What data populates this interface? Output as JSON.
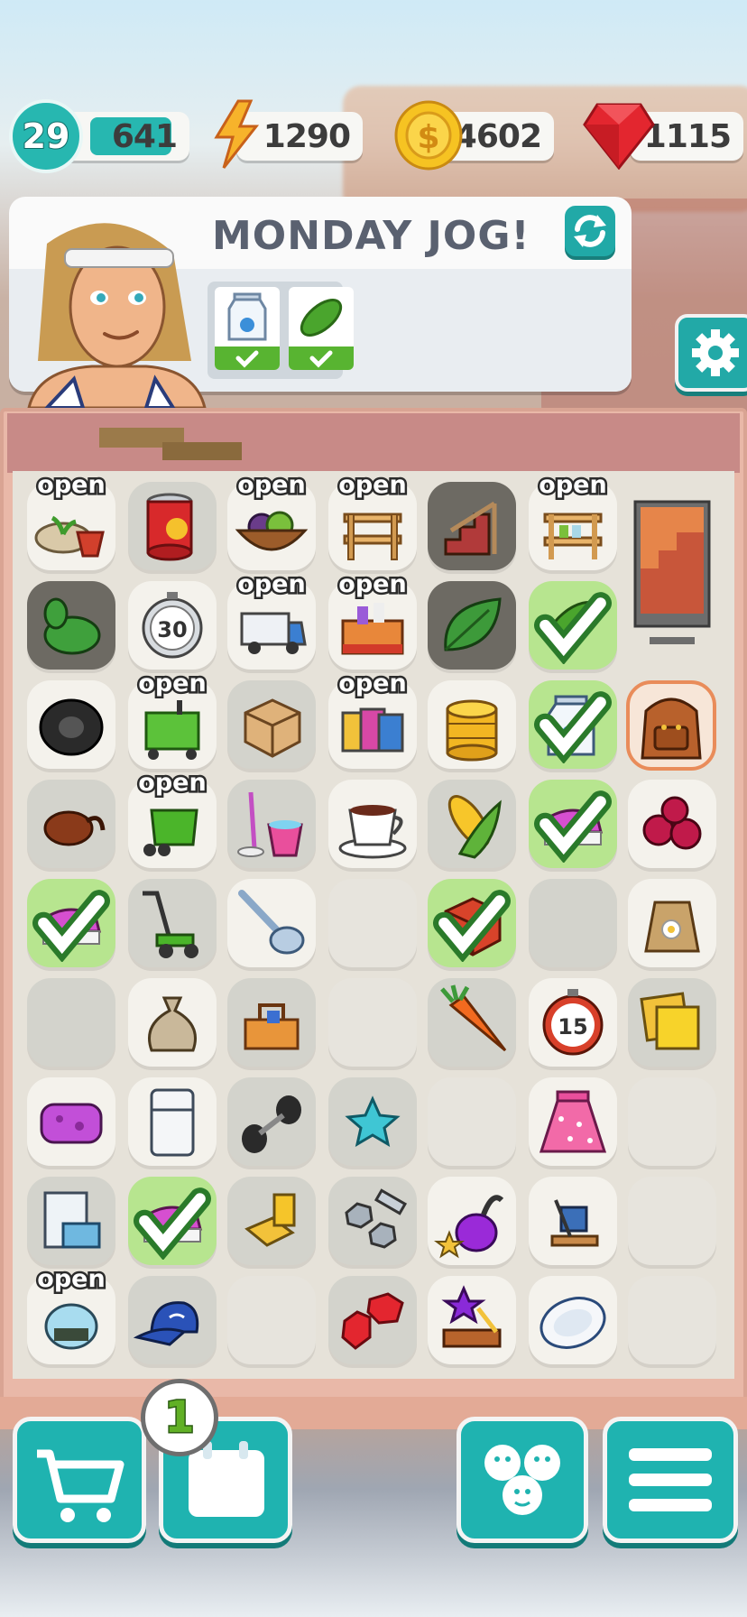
{
  "status_bar": {
    "level": "29",
    "xp": "641",
    "energy": "1290",
    "coins": "4602",
    "gems": "1115"
  },
  "task": {
    "title": "MONDAY JOG!",
    "requirements": [
      "milk",
      "pickle"
    ]
  },
  "board": {
    "open_label": "open",
    "rows": [
      [
        "seedling-pot (open)",
        "tomato-can",
        "fruit-bowl (open)",
        "shelf (open)",
        "stairs",
        "shelf-jars (open)"
      ],
      [
        "green-plant-monster",
        "timer-30",
        "truck (open)",
        "toolbox (open)",
        "leaf",
        "pickle ✓"
      ],
      [
        "tire",
        "shopping-cart (open)",
        "wooden-box",
        "shopping-bags (open)",
        "coin-stack",
        "milk ✓"
      ],
      [
        "acorn",
        "cart (open)",
        "mop-bucket",
        "coffee-cup",
        "corn",
        "scrub-brush ✓",
        "berries"
      ],
      [
        "scrub-brush ✓",
        "lawn-mower",
        "ladle",
        "",
        "brick ✓",
        "",
        "seed-bag"
      ],
      [
        "",
        "sack",
        "toolbox",
        "",
        "carrot",
        "timer-15",
        "sticky-notes"
      ],
      [
        "sponge",
        "fridge",
        "dumbbell",
        "star",
        "",
        "skirt",
        ""
      ],
      [
        "air-conditioner",
        "scrub-brush ✓",
        "gold-bars",
        "bolts",
        "vacuum",
        "tools",
        ""
      ],
      [
        "fishbowl (open)",
        "cap",
        "",
        "rubies",
        "star-book",
        "plate",
        ""
      ]
    ],
    "timer_30": "30",
    "timer_15": "15"
  },
  "bottom_bar": {
    "calendar_badge": "1"
  },
  "colors": {
    "accent": "#1fb3b0",
    "check": "#58b431"
  }
}
